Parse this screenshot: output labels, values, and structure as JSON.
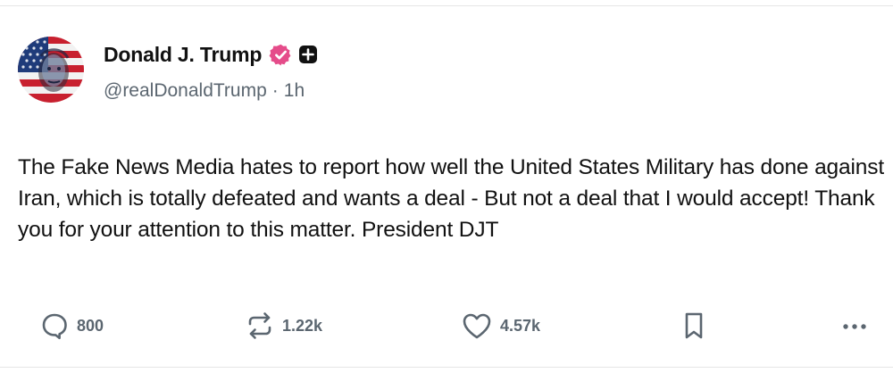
{
  "post": {
    "author": {
      "display_name": "Donald J. Trump",
      "handle": "@realDonaldTrump",
      "separator": "·",
      "time_ago": "1h",
      "avatar_icon": "flag-portrait-avatar",
      "verified_icon": "verified-badge-icon",
      "verified_color": "#e54c8a",
      "plus_icon": "plus-badge-icon"
    },
    "text": "The Fake News Media hates to report how well the United States Military has done against Iran, which is totally defeated and wants a deal - But not a deal that I would accept! Thank you for your attention to this matter. President DJT",
    "actions": {
      "replies": {
        "icon": "reply-icon",
        "count": "800"
      },
      "reposts": {
        "icon": "repost-icon",
        "count": "1.22k"
      },
      "likes": {
        "icon": "heart-icon",
        "count": "4.57k"
      },
      "bookmark": {
        "icon": "bookmark-icon"
      },
      "more": {
        "icon": "more-icon"
      }
    }
  }
}
